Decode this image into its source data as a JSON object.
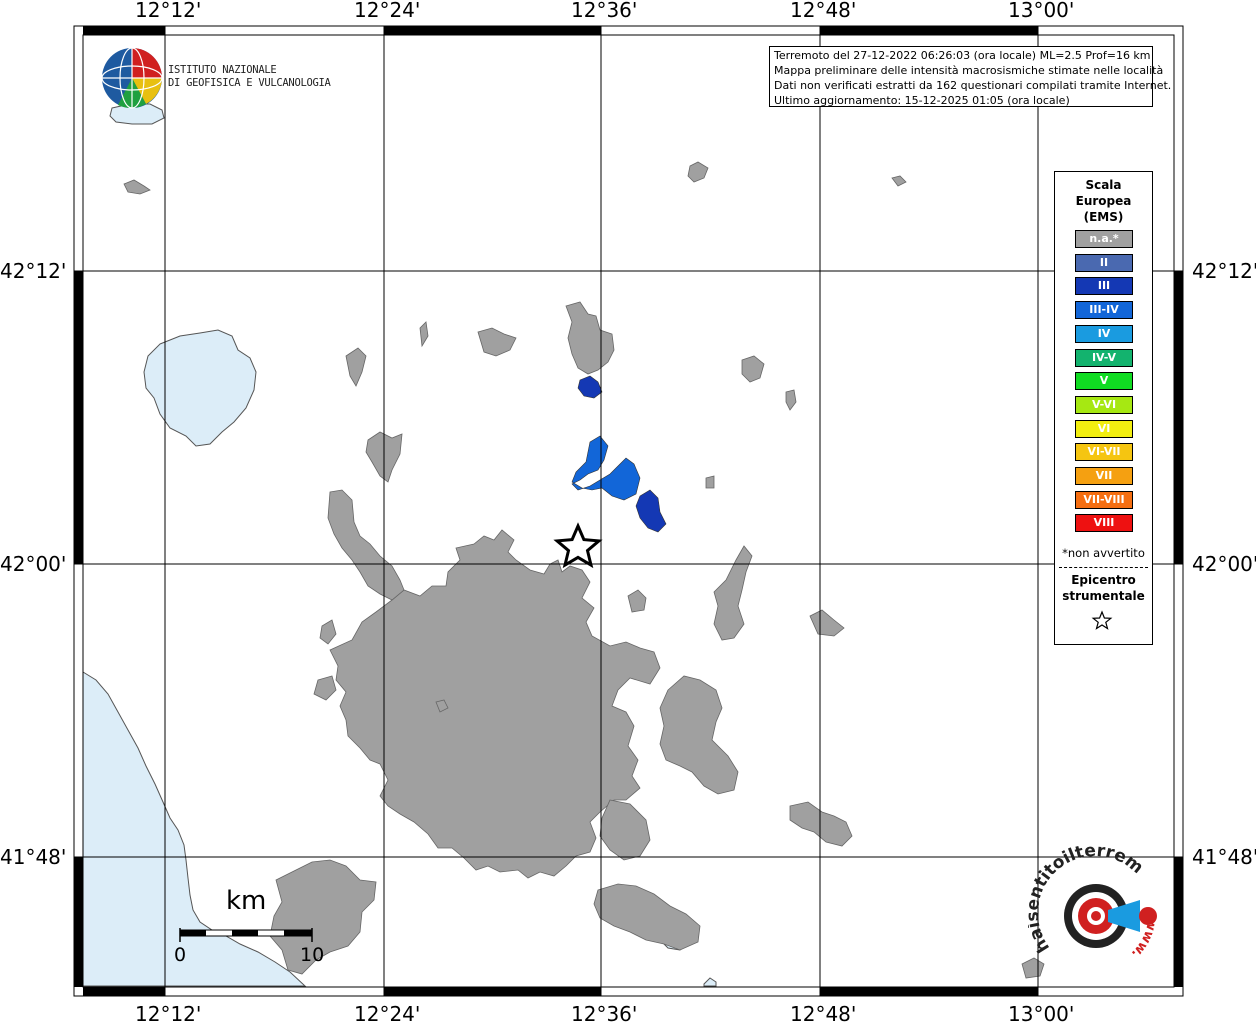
{
  "map": {
    "longitude_labels": [
      "12°12'",
      "12°24'",
      "12°36'",
      "12°48'",
      "13°00'"
    ],
    "latitude_labels": [
      "42°12'",
      "42°00'",
      "41°48'"
    ]
  },
  "info": {
    "line1": "Terremoto del 27-12-2022 06:26:03 (ora locale) ML=2.5 Prof=16 km",
    "line2": "Mappa preliminare delle intensità macrosismiche stimate nelle località",
    "line3": "Dati non verificati estratti da 162 questionari compilati tramite Internet.",
    "line4": "Ultimo aggiornamento: 15-12-2025 01:05 (ora locale)"
  },
  "logo": {
    "line1": "ISTITUTO NAZIONALE",
    "line2": "DI GEOFISICA E VULCANOLOGIA"
  },
  "legend": {
    "title_line1": "Scala",
    "title_line2": "Europea",
    "title_line3": "(EMS)",
    "items": [
      {
        "label": "n.a.*",
        "color": "#a0a0a0"
      },
      {
        "label": "II",
        "color": "#4a69b0"
      },
      {
        "label": "III",
        "color": "#1438b4"
      },
      {
        "label": "III-IV",
        "color": "#1266d8"
      },
      {
        "label": "IV",
        "color": "#1a9be0"
      },
      {
        "label": "IV-V",
        "color": "#13b36e"
      },
      {
        "label": "V",
        "color": "#10dc22"
      },
      {
        "label": "V-VI",
        "color": "#a6e812"
      },
      {
        "label": "VI",
        "color": "#f2ee10"
      },
      {
        "label": "VI-VII",
        "color": "#f5c511"
      },
      {
        "label": "VII",
        "color": "#f5a011"
      },
      {
        "label": "VII-VIII",
        "color": "#f56e11"
      },
      {
        "label": "VIII",
        "color": "#ee1111"
      }
    ],
    "note": "*non avvertito",
    "epicenter_line1": "Epicentro",
    "epicenter_line2": "strumentale"
  },
  "scale_bar": {
    "unit": "km",
    "start": "0",
    "end": "10"
  },
  "site_logo": {
    "text": "haisentitoilterremoto.it",
    "url_text": "www."
  },
  "colors": {
    "urban": "#a0a0a0",
    "water": "#dcedf8",
    "grid": "#000000",
    "intensity_III": "#1438b4",
    "intensity_III_IV": "#1266d8"
  }
}
